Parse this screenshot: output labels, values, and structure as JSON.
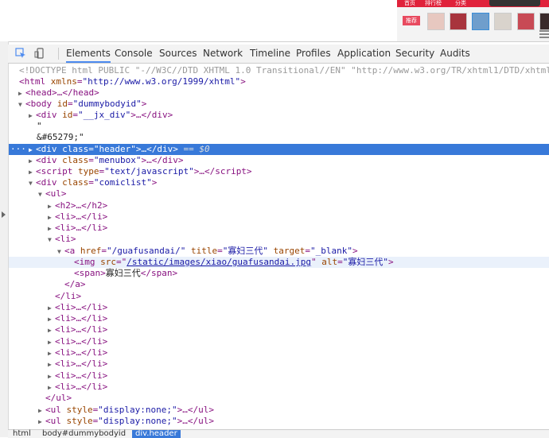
{
  "page": {
    "red_bar_items": [
      "首页",
      "排行榜",
      "分类"
    ],
    "red_button": "推荐"
  },
  "toolbar": {
    "tabs": [
      "Elements",
      "Console",
      "Sources",
      "Network",
      "Timeline",
      "Profiles",
      "Application",
      "Security",
      "Audits"
    ],
    "active_tab": "Elements"
  },
  "tree": {
    "doctype": "<!DOCTYPE html PUBLIC \"-//W3C//DTD XHTML 1.0 Transitional//EN\" \"http://www.w3.org/TR/xhtml1/DTD/xhtml",
    "html_tag": "html",
    "xmlns_attr": "xmlns",
    "xmlns_val": "\"http://www.w3.org/1999/xhtml\"",
    "head": "<head>…</head>",
    "body_tag": "body",
    "body_id_attr": "id",
    "body_id_val": "\"dummybodyid\"",
    "jx_div_attr": "id",
    "jx_div_val": "\"__jx_div\"",
    "quote": "\"",
    "entity": "&#65279;\"",
    "dots": "…",
    "header_class": "\"header\"",
    "eq_dollar": " == $0",
    "menubox_class": "\"menubox\"",
    "script_type": "\"text/javascript\"",
    "comiclist_class": "\"comiclist\"",
    "href_val": "\"/guafusandai/\"",
    "title_val": "\"寡妇三代\"",
    "target_val": "\"_blank\"",
    "img_src": "/static/images/xiao/guafusandai.jpg",
    "img_alt": "\"寡妇三代\"",
    "span_text": "寡妇三代",
    "ul_style": "\"display:none;\""
  },
  "breadcrumb": [
    "html",
    "body#dummybodyid",
    "div.header"
  ],
  "colors": {
    "selected": "#3879d9",
    "tag": "#881280",
    "attr_name": "#994500",
    "attr_value": "#1a1aa6"
  }
}
